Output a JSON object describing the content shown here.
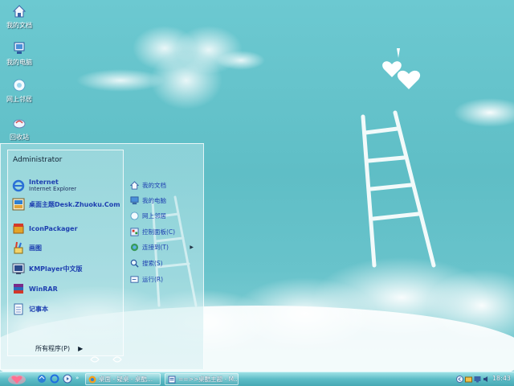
{
  "desktop": {
    "icons": [
      {
        "label": "我的文档",
        "icon": "my-documents-icon"
      },
      {
        "label": "我的电脑",
        "icon": "my-computer-icon"
      },
      {
        "label": "网上邻居",
        "icon": "network-places-icon"
      },
      {
        "label": "回收站",
        "icon": "recycle-bin-icon"
      }
    ]
  },
  "start_menu": {
    "user": "Administrator",
    "pinned": [
      {
        "title": "Internet",
        "subtitle": "Internet Explorer",
        "icon": "internet-explorer-icon"
      },
      {
        "title": "桌面主题Desk.Zhuoku.Com",
        "icon": "theme-site-icon"
      },
      {
        "title": "IconPackager",
        "icon": "iconpackager-icon"
      },
      {
        "title": "画图",
        "icon": "paint-icon"
      },
      {
        "title": "KMPlayer中文版",
        "icon": "kmplayer-icon"
      },
      {
        "title": "WinRAR",
        "icon": "winrar-icon"
      },
      {
        "title": "记事本",
        "icon": "notepad-icon"
      }
    ],
    "all_programs": "所有程序(P)",
    "right_items": [
      {
        "label": "我的文档",
        "icon": "my-documents-icon"
      },
      {
        "label": "我的电脑",
        "icon": "my-computer-icon"
      },
      {
        "label": "网上邻居",
        "icon": "network-places-icon"
      },
      {
        "label": "控制面板(C)",
        "icon": "control-panel-icon"
      },
      {
        "label": "连接到(T)",
        "icon": "connect-to-icon",
        "has_submenu": true
      },
      {
        "label": "搜索(S)",
        "icon": "search-icon"
      },
      {
        "label": "运行(R)",
        "icon": "run-icon"
      }
    ]
  },
  "taskbar": {
    "tasks": [
      {
        "label": "桌面 - 疑桌 - 桌酷...",
        "icon": "browser-icon"
      },
      {
        "label": "==>>桌酷主题 - M...",
        "icon": "document-icon"
      }
    ],
    "clock": "18:43"
  },
  "colors": {
    "sky": "#6cc9d1",
    "link_blue": "#1e3fb0",
    "taskbar": "#5cbcc6"
  }
}
